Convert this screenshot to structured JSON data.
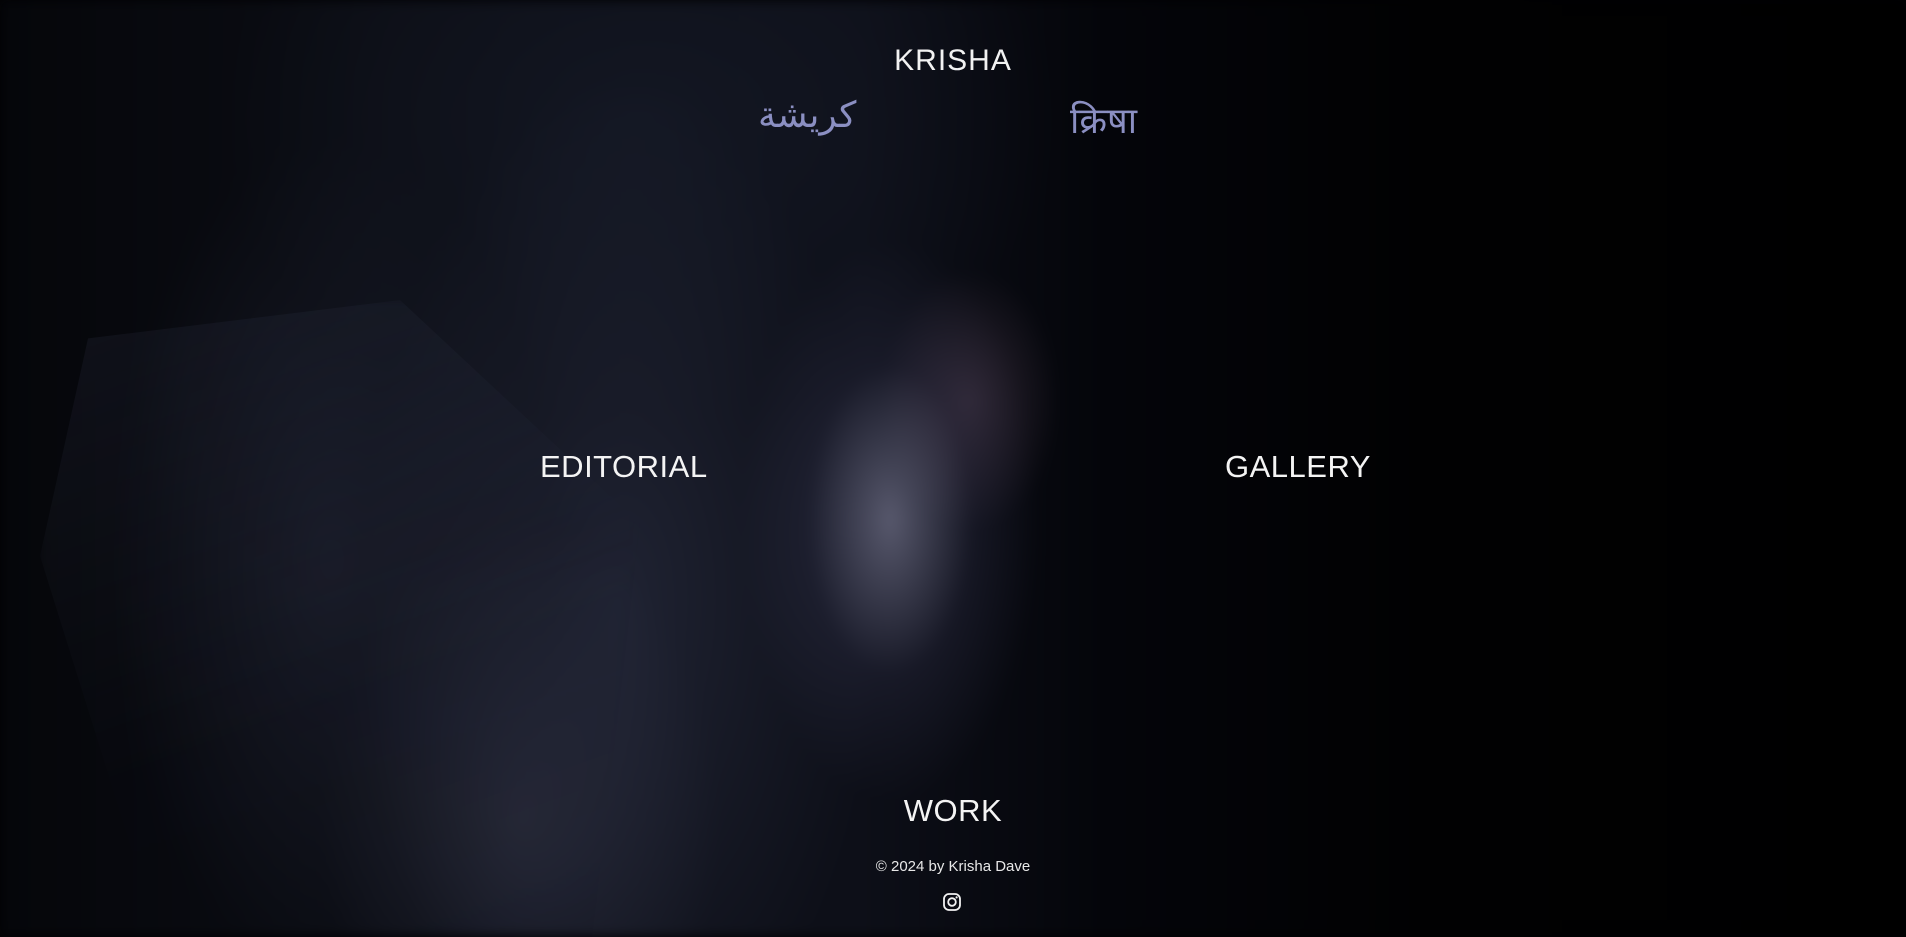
{
  "site": {
    "title": "KRISHA",
    "name_arabic": "كريشة",
    "name_devanagari": "क्रिषा"
  },
  "nav": {
    "editorial": "EDITORIAL",
    "gallery": "GALLERY",
    "work": "WORK"
  },
  "footer": {
    "copyright": "© 2024 by Krisha Dave",
    "social_icon": "instagram-icon"
  },
  "colors": {
    "text": "#f2f2f2",
    "script_accent": "#8b8fc2",
    "background": "#000000"
  }
}
